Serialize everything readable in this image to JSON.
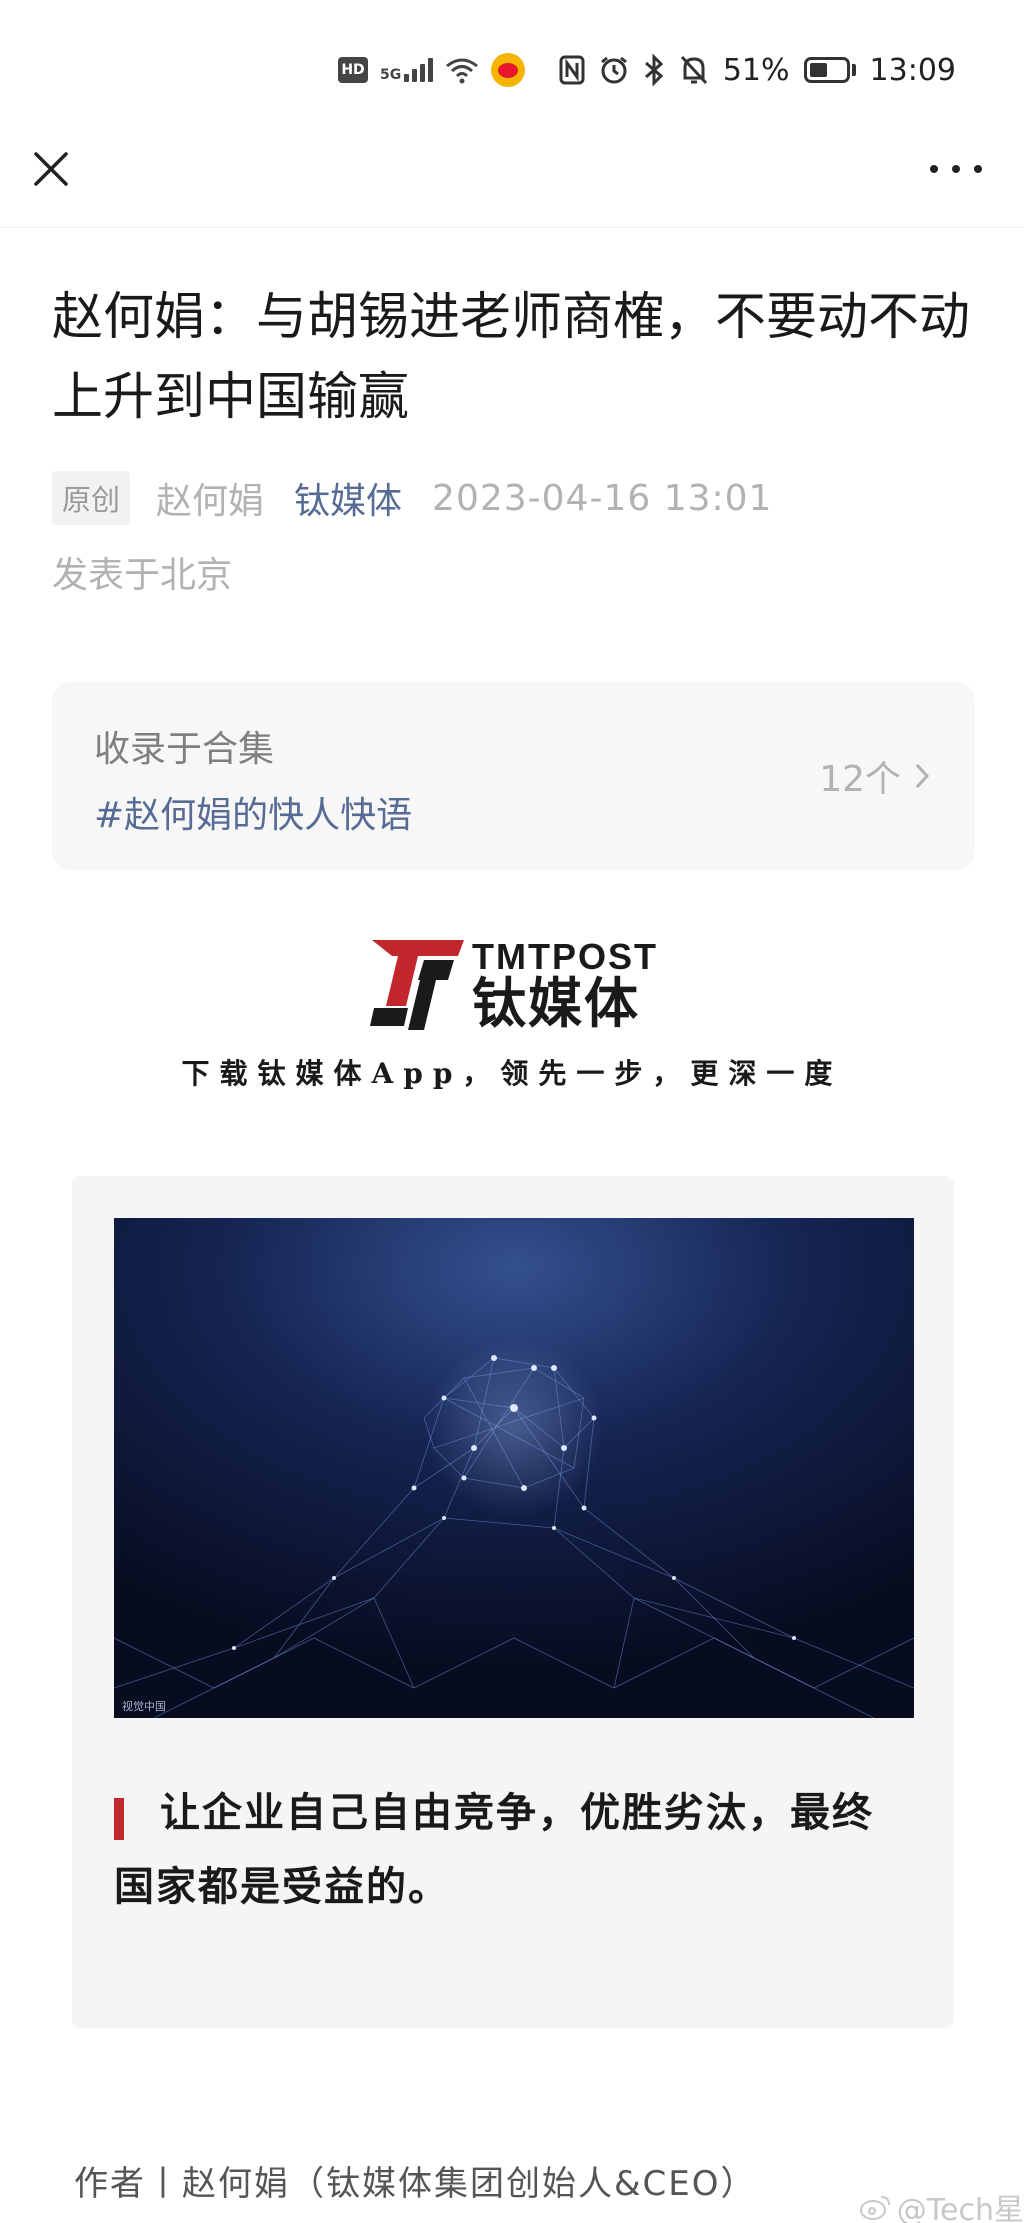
{
  "status_bar": {
    "hd": "HD",
    "network": "5G",
    "battery_percent": "51%",
    "battery_level": 0.51,
    "time": "13:09"
  },
  "nav": {
    "close_icon": "close-icon",
    "more_icon": "more-icon"
  },
  "article": {
    "title": "赵何娟：与胡锡进老师商榷，不要动不动上升到中国输赢",
    "original_badge": "原创",
    "author": "赵何娟",
    "account": "钛媒体",
    "date": "2023-04-16 13:01",
    "location": "发表于北京"
  },
  "collection": {
    "label": "收录于合集",
    "name": "#赵何娟的快人快语",
    "count": "12个"
  },
  "logo": {
    "en": "TMTPOST",
    "cn": "钛媒体",
    "slogan": "下载钛媒体App，领先一步，更深一度"
  },
  "quote_card": {
    "image_credit": "视觉中国",
    "quote": "让企业自己自由竞争，优胜劣汰，最终国家都是受益的。"
  },
  "byline": {
    "text": "作者丨赵何娟（钛媒体集团创始人&CEO）"
  },
  "watermark": {
    "text": "@Tech星"
  },
  "colors": {
    "link_blue": "#576b95",
    "accent_red": "#c1272d",
    "meta_gray": "#b2b2b2"
  }
}
